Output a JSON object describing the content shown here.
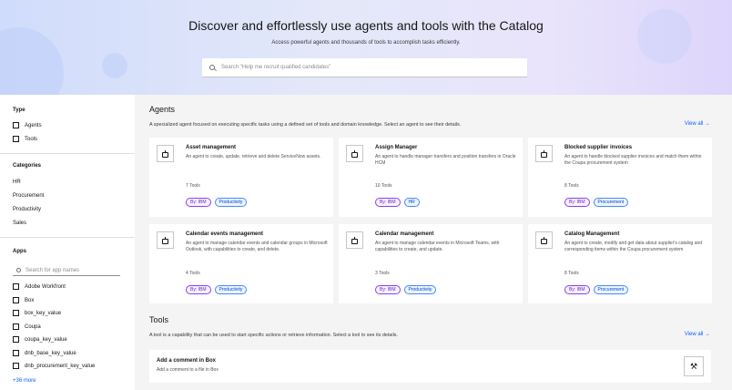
{
  "hero": {
    "title": "Discover and effortlessly use agents and tools with the Catalog",
    "subtitle": "Access powerful agents and thousands of tools to accomplish tasks efficiently.",
    "search_placeholder": "Search \"Help me recruit qualified candidates\""
  },
  "sidebar": {
    "type": {
      "title": "Type",
      "items": [
        "Agents",
        "Tools"
      ]
    },
    "categories": {
      "title": "Categories",
      "items": [
        "HR",
        "Procurement",
        "Productivity",
        "Sales"
      ]
    },
    "apps": {
      "title": "Apps",
      "search_placeholder": "Search for app names",
      "items": [
        "Adobe Workfront",
        "Box",
        "box_key_value",
        "Coupa",
        "coupa_key_value",
        "dnb_base_key_value",
        "dnb_procurement_key_value"
      ],
      "more": "+36 more"
    }
  },
  "agents": {
    "title": "Agents",
    "description": "A specialized agent focused on executing specific tasks using a defined set of tools and domain knowledge. Select an agent to see their details.",
    "view_all": "View all",
    "cards": [
      {
        "title": "Asset management",
        "desc": "An agent to create, update, retrieve and delete ServiceNow assets.",
        "tools": "7 Tools",
        "tags": [
          "By: IBM",
          "Productivity"
        ]
      },
      {
        "title": "Assign Manager",
        "desc": "An agent to handle manager transfers and position transfers in Oracle HCM",
        "tools": "10 Tools",
        "tags": [
          "By: IBM",
          "HR"
        ]
      },
      {
        "title": "Blocked supplier invoices",
        "desc": "An agent to handle blocked supplier invoices and match them within the Coupa procurement system",
        "tools": "8 Tools",
        "tags": [
          "By: IBM",
          "Procurement"
        ]
      },
      {
        "title": "Calendar events management",
        "desc": "An agent to manage calendar events and calendar groups in Microsoft Outlook, with capabilities to create, and delete.",
        "tools": "4 Tools",
        "tags": [
          "By: IBM",
          "Productivity"
        ]
      },
      {
        "title": "Calendar management",
        "desc": "An agent to manage calendar events in Microsoft Teams, with capabilities to create, and update.",
        "tools": "3 Tools",
        "tags": [
          "By: IBM",
          "Productivity"
        ]
      },
      {
        "title": "Catalog Management",
        "desc": "An agent to create, modify and get data about supplier's catalog and corresponding items within the Coupa procurement system",
        "tools": "8 Tools",
        "tags": [
          "By: IBM",
          "Procurement"
        ]
      }
    ]
  },
  "tools": {
    "title": "Tools",
    "description": "A tool is a capability that can be used to start specific actions or retrieve information. Select a tool to see its details.",
    "view_all": "View all",
    "first": {
      "title": "Add a comment in Box",
      "desc": "Add a comment to a file in Box"
    }
  },
  "colors": {
    "accent": "#0f62fe",
    "tag_purple": "#8a3ffc",
    "tag_blue": "#4589ff"
  }
}
